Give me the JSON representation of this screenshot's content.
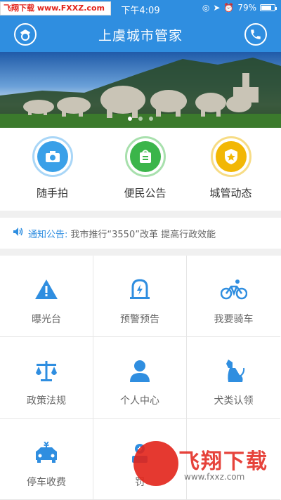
{
  "status_bar": {
    "watermark": "飞翔下载 www.FXXZ.com",
    "time": "下午4:09",
    "battery": "79%",
    "battery_level": 0.79
  },
  "header": {
    "title": "上虞城市管家",
    "left_icon": "police-avatar-icon",
    "right_icon": "phone-icon"
  },
  "banner": {
    "slides": 3,
    "active_slide": 0
  },
  "quick_actions": [
    {
      "label": "随手拍",
      "icon": "camera-icon",
      "color": "#3aa0e8"
    },
    {
      "label": "便民公告",
      "icon": "notice-bag-icon",
      "color": "#3bb54a"
    },
    {
      "label": "城管动态",
      "icon": "badge-star-icon",
      "color": "#f2b705"
    }
  ],
  "notice": {
    "label": "通知公告:",
    "text": "我市推行“3550”改革 提高行政效能"
  },
  "grid": [
    {
      "label": "曝光台",
      "icon": "warning-icon"
    },
    {
      "label": "预警预告",
      "icon": "alarm-icon"
    },
    {
      "label": "我要骑车",
      "icon": "bicycle-icon"
    },
    {
      "label": "政策法规",
      "icon": "scales-icon"
    },
    {
      "label": "个人中心",
      "icon": "person-icon"
    },
    {
      "label": "犬类认领",
      "icon": "dog-icon"
    },
    {
      "label": "停车收费",
      "icon": "parking-fee-icon"
    },
    {
      "label": "罚",
      "icon": "fine-icon"
    },
    {
      "label": "",
      "icon": ""
    }
  ],
  "watermark_bottom": {
    "title": "飞翔下载",
    "url": "www.fxxz.com"
  },
  "colors": {
    "primary": "#2f8ee0",
    "watermark_red": "#e2231a"
  }
}
